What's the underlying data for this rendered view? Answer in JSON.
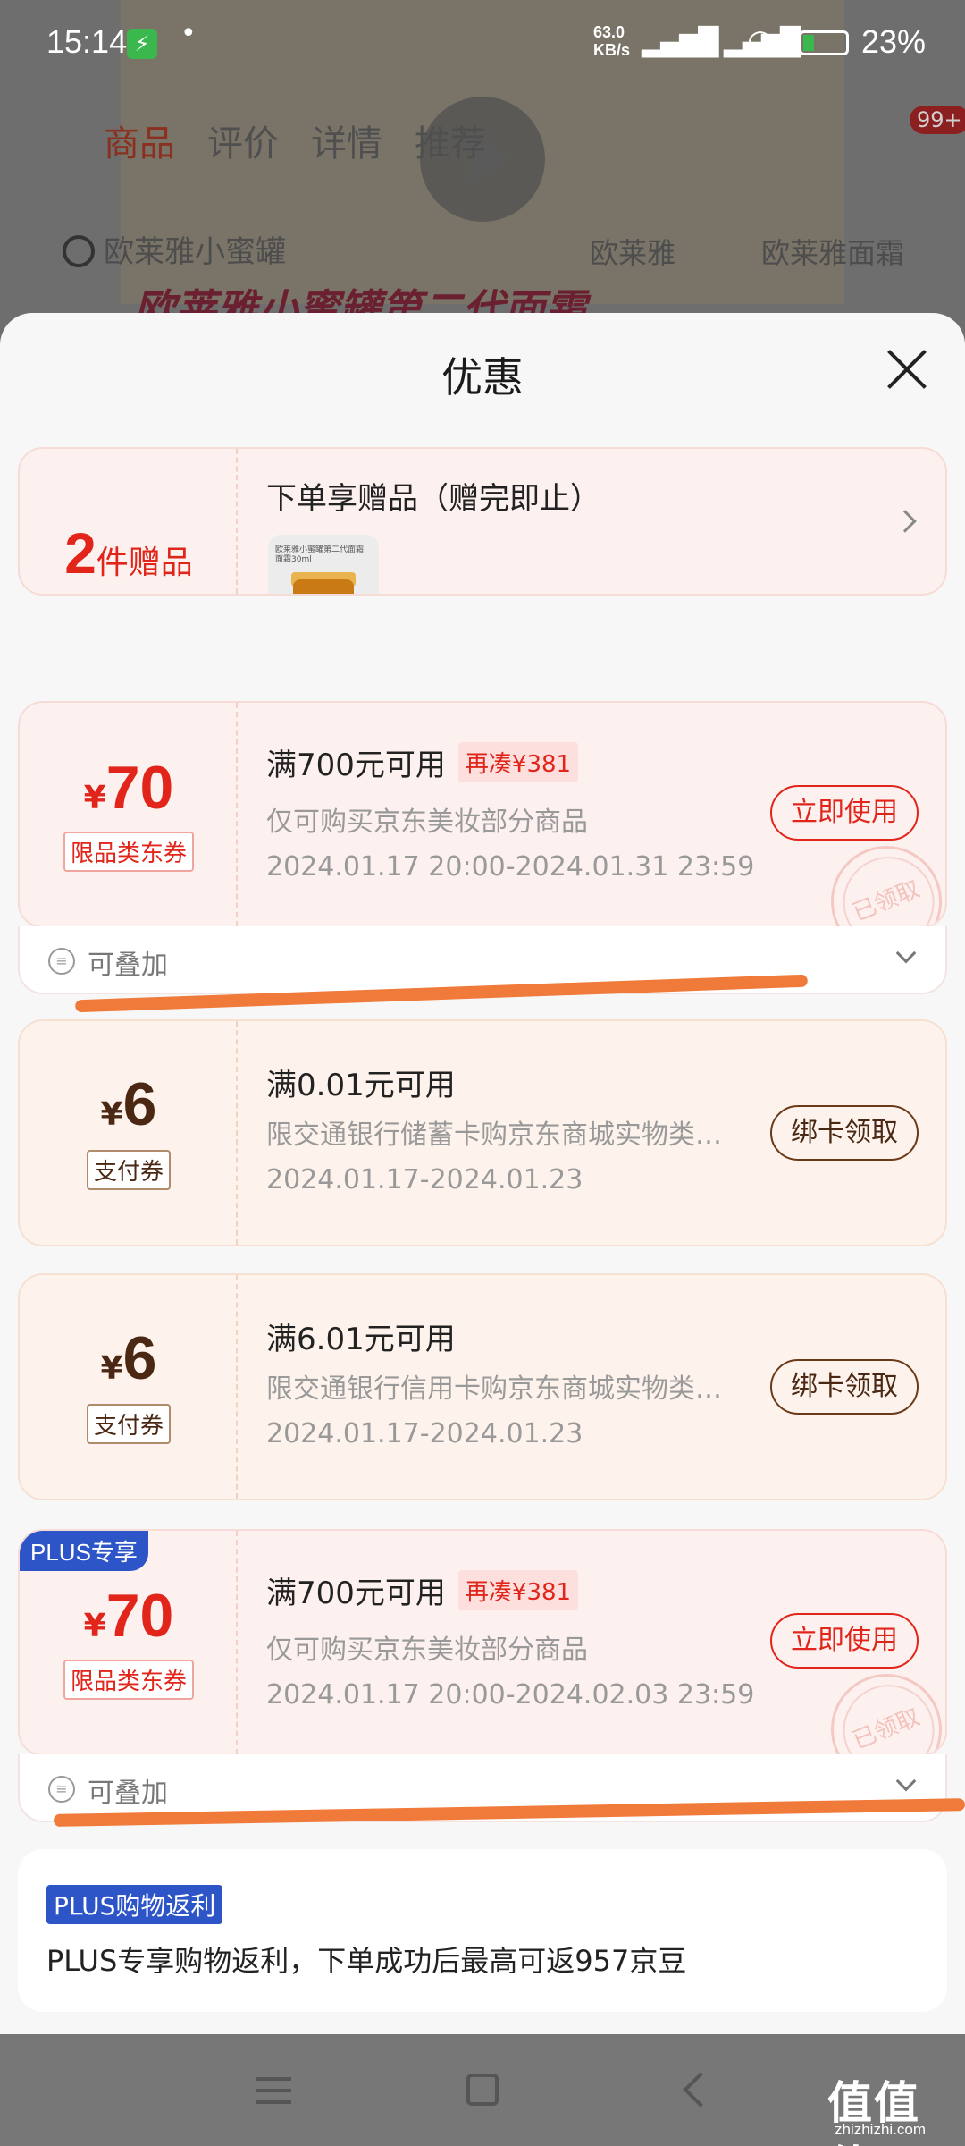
{
  "status_bar": {
    "time": "15:14",
    "net_speed": "63.0\nKB/s",
    "battery": "23%"
  },
  "background": {
    "tabs": [
      "商品",
      "评价",
      "详情",
      "推荐"
    ],
    "badge": "99+",
    "search_text": "欧莱雅小蜜罐",
    "chip1": "欧莱雅",
    "chip2": "欧莱雅面霜",
    "banner": "欧莱雅小蜜罐第二代面霜"
  },
  "sheet": {
    "title": "优惠"
  },
  "gift_card": {
    "count": "2",
    "count_unit": "件赠品",
    "title": "下单享赠品（赠完即止）",
    "thumb_caption": "欧莱雅小蜜罐第二代面霜 面霜30ml"
  },
  "coupons": [
    {
      "currency": "¥",
      "amount": "70",
      "type": "限品类东券",
      "condition": "满700元可用",
      "topup": "再凑¥381",
      "scope": "仅可购买京东美妆部分商品",
      "period": "2024.01.17 20:00-2024.01.31 23:59",
      "button": "立即使用",
      "stamp": "已领取",
      "stack": "可叠加"
    },
    {
      "currency": "¥",
      "amount": "6",
      "type": "支付券",
      "condition": "满0.01元可用",
      "scope": "限交通银行储蓄卡购京东商城实物类…",
      "period": "2024.01.17-2024.01.23",
      "button": "绑卡领取"
    },
    {
      "currency": "¥",
      "amount": "6",
      "type": "支付券",
      "condition": "满6.01元可用",
      "scope": "限交通银行信用卡购京东商城实物类…",
      "period": "2024.01.17-2024.01.23",
      "button": "绑卡领取"
    },
    {
      "plus_badge": "PLUS专享",
      "currency": "¥",
      "amount": "70",
      "type": "限品类东券",
      "condition": "满700元可用",
      "topup": "再凑¥381",
      "scope": "仅可购买京东美妆部分商品",
      "period": "2024.01.17 20:00-2024.02.03 23:59",
      "button": "立即使用",
      "stamp": "已领取",
      "stack": "可叠加"
    }
  ],
  "rebate": {
    "badge": "PLUS购物返利",
    "text": "PLUS专享购物返利，下单成功后最高可返957京豆"
  },
  "watermark": {
    "text": "值值值",
    "url": "zhizhizhi.com"
  },
  "colors": {
    "accent_red": "#e1251b",
    "plus_blue": "#2d55c8",
    "annotation_orange": "#f07a3a"
  }
}
